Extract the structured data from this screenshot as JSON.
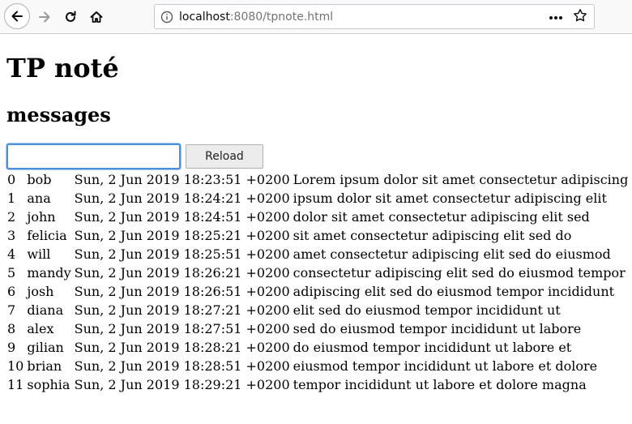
{
  "browser": {
    "url_host": "localhost",
    "url_rest": ":8080/tpnote.html"
  },
  "page": {
    "title": "TP noté",
    "subtitle": "messages",
    "input_value": "",
    "reload_label": "Reload"
  },
  "messages": [
    {
      "id": "0",
      "user": "bob",
      "date": "Sun, 2 Jun 2019 18:23:51 +0200",
      "text": "Lorem ipsum dolor sit amet consectetur adipiscing"
    },
    {
      "id": "1",
      "user": "ana",
      "date": "Sun, 2 Jun 2019 18:24:21 +0200",
      "text": "ipsum dolor sit amet consectetur adipiscing elit"
    },
    {
      "id": "2",
      "user": "john",
      "date": "Sun, 2 Jun 2019 18:24:51 +0200",
      "text": "dolor sit amet consectetur adipiscing elit sed"
    },
    {
      "id": "3",
      "user": "felicia",
      "date": "Sun, 2 Jun 2019 18:25:21 +0200",
      "text": "sit amet consectetur adipiscing elit sed do"
    },
    {
      "id": "4",
      "user": "will",
      "date": "Sun, 2 Jun 2019 18:25:51 +0200",
      "text": "amet consectetur adipiscing elit sed do eiusmod"
    },
    {
      "id": "5",
      "user": "mandy",
      "date": "Sun, 2 Jun 2019 18:26:21 +0200",
      "text": "consectetur adipiscing elit sed do eiusmod tempor"
    },
    {
      "id": "6",
      "user": "josh",
      "date": "Sun, 2 Jun 2019 18:26:51 +0200",
      "text": "adipiscing elit sed do eiusmod tempor incididunt"
    },
    {
      "id": "7",
      "user": "diana",
      "date": "Sun, 2 Jun 2019 18:27:21 +0200",
      "text": "elit sed do eiusmod tempor incididunt ut"
    },
    {
      "id": "8",
      "user": "alex",
      "date": "Sun, 2 Jun 2019 18:27:51 +0200",
      "text": "sed do eiusmod tempor incididunt ut labore"
    },
    {
      "id": "9",
      "user": "gilian",
      "date": "Sun, 2 Jun 2019 18:28:21 +0200",
      "text": "do eiusmod tempor incididunt ut labore et"
    },
    {
      "id": "10",
      "user": "brian",
      "date": "Sun, 2 Jun 2019 18:28:51 +0200",
      "text": "eiusmod tempor incididunt ut labore et dolore"
    },
    {
      "id": "11",
      "user": "sophia",
      "date": "Sun, 2 Jun 2019 18:29:21 +0200",
      "text": "tempor incididunt ut labore et dolore magna"
    }
  ],
  "icons": {
    "back": "back-arrow-icon",
    "forward": "forward-arrow-icon",
    "reload": "reload-icon",
    "home": "home-icon",
    "info": "info-icon",
    "more": "more-dots-icon",
    "bookmark": "star-icon"
  },
  "colors": {
    "input_focus": "#4a90d9",
    "toolbar_bg": "#f9f9fa"
  }
}
